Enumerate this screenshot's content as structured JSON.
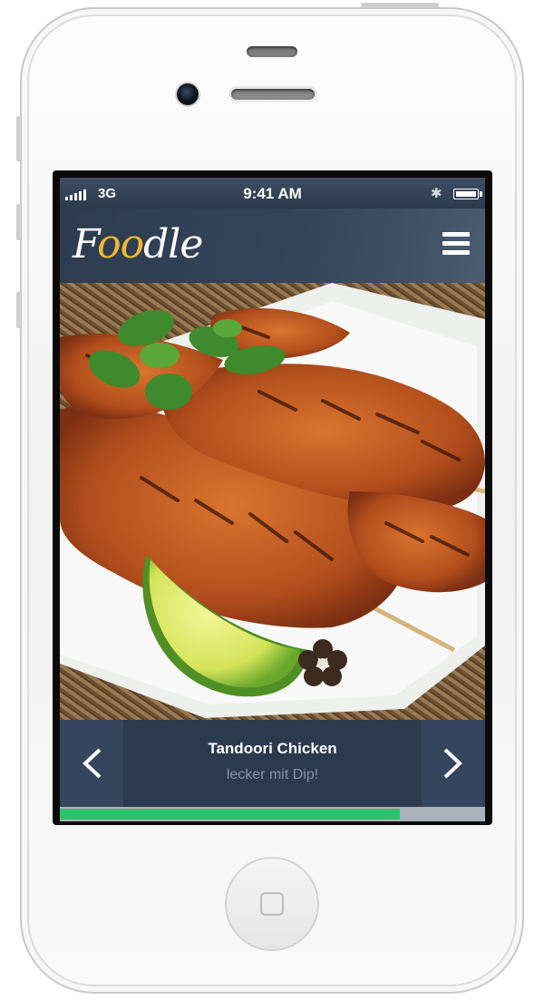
{
  "status_bar": {
    "carrier": "3G",
    "time": "9:41 AM",
    "bluetooth_icon": "bluetooth-icon",
    "battery_icon": "battery-icon"
  },
  "app": {
    "logo": {
      "prefix": "F",
      "accent": "oo",
      "suffix": "dle"
    },
    "menu_icon": "hamburger-menu-icon",
    "accent_color": "#f0b830"
  },
  "slide": {
    "title": "Tandoori Chicken",
    "subtitle": "lecker mit Dip!",
    "prev_icon": "chevron-left-icon",
    "next_icon": "chevron-right-icon"
  },
  "progress": {
    "value": 0.8,
    "color": "#2fc16c"
  }
}
